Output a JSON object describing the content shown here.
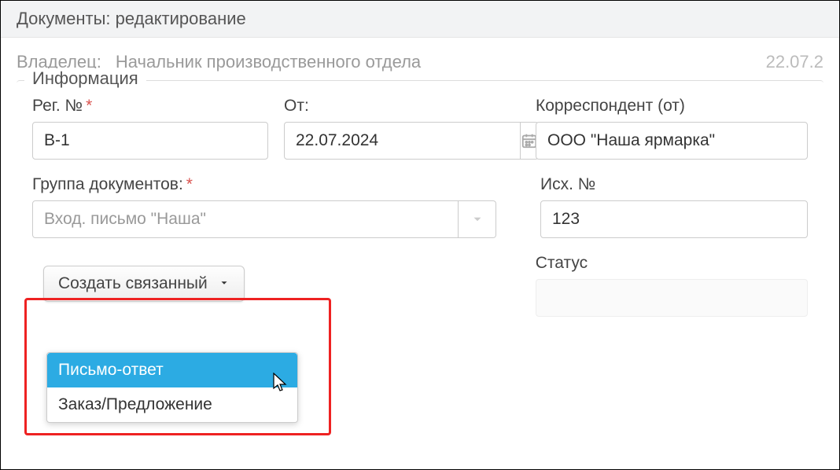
{
  "header": {
    "title": "Документы: редактирование"
  },
  "owner": {
    "label": "Владелец:",
    "value": "Начальник производственного отдела",
    "date": "22.07.2"
  },
  "fieldset": {
    "legend": "Информация"
  },
  "fields": {
    "reg_no": {
      "label": "Рег. №",
      "value": "В-1"
    },
    "from_date": {
      "label": "От:",
      "value": "22.07.2024"
    },
    "correspondent": {
      "label": "Корреспондент (от)",
      "value": "ООО \"Наша ярмарка\""
    },
    "doc_group": {
      "label": "Группа документов:",
      "value": "Вход. письмо \"Наша\""
    },
    "outgoing_no": {
      "label": "Исх. №",
      "value": "123"
    },
    "status": {
      "label": "Статус",
      "value": ""
    }
  },
  "create_linked": {
    "button_label": "Создать связанный",
    "options": [
      "Письмо-ответ",
      "Заказ/Предложение"
    ]
  }
}
